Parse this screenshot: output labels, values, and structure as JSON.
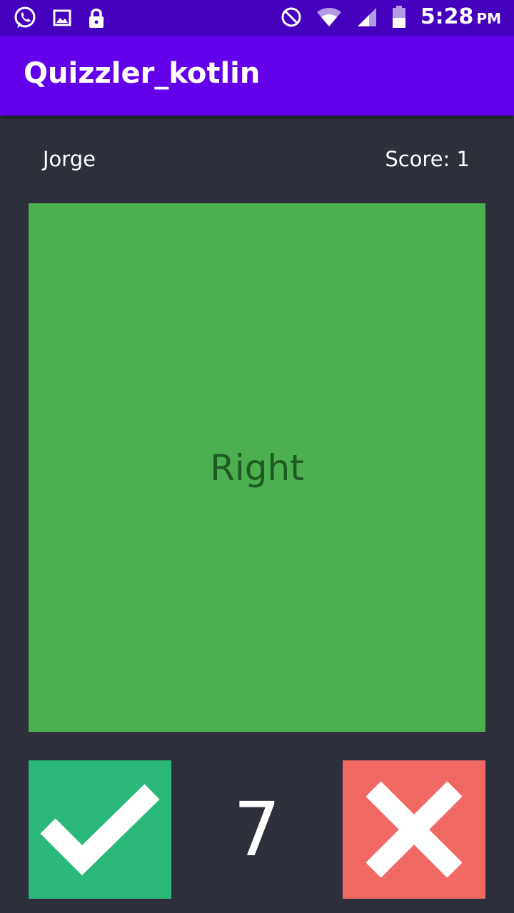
{
  "status_bar": {
    "time": "5:28",
    "ampm": "PM",
    "left_icons": [
      "whatsapp-icon",
      "image-icon",
      "lock-icon"
    ],
    "right_icons": [
      "do-not-disturb-icon",
      "wifi-icon",
      "signal-icon",
      "battery-icon"
    ],
    "color": "#4500bd"
  },
  "app_bar": {
    "title": "Quizzler_kotlin",
    "color": "#6200ea"
  },
  "header": {
    "player_name": "Jorge",
    "score": "Score: 1"
  },
  "question": {
    "text": "Right",
    "card_color": "#4caf50",
    "text_color": "#1e5a22"
  },
  "controls": {
    "true_icon": "check-icon",
    "true_color": "#29b87a",
    "question_number": "7",
    "false_icon": "close-icon",
    "false_color": "#f06862"
  }
}
